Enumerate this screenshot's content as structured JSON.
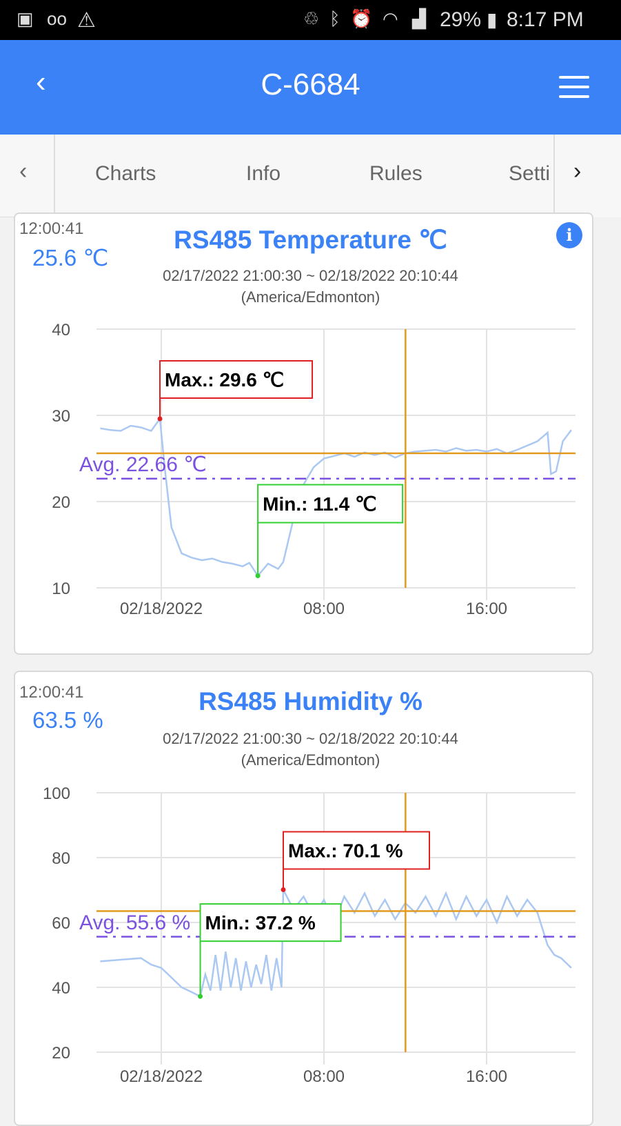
{
  "status_bar": {
    "left_icons": [
      "pulse-icon",
      "voicemail-icon",
      "warning-icon"
    ],
    "right_icons": [
      "data-saver-icon",
      "bluetooth-icon",
      "alarm-icon",
      "wifi-icon",
      "signal-icon"
    ],
    "battery": "29%",
    "time": "8:17 PM"
  },
  "header": {
    "title": "C-6684",
    "back_icon": "chevron-left-icon",
    "menu_icon": "hamburger-icon",
    "color": "#3b82f6"
  },
  "tabs": {
    "items": [
      {
        "label": "Charts",
        "active": true
      },
      {
        "label": "Info"
      },
      {
        "label": "Rules"
      },
      {
        "label": "Setti"
      }
    ]
  },
  "charts": [
    {
      "last_time": "12:00:41",
      "current": "25.6 ℃",
      "title": "RS485 Temperature ℃",
      "range": "02/17/2022 21:00:30 ~ 02/18/2022 20:10:44",
      "timezone": "(America/Edmonton)",
      "info_icon": "info-icon"
    },
    {
      "last_time": "12:00:41",
      "current": "63.5 %",
      "title": "RS485 Humidity %",
      "range": "02/17/2022 21:00:30 ~ 02/18/2022 20:10:44",
      "timezone": "(America/Edmonton)"
    }
  ],
  "chart_data": [
    {
      "type": "line",
      "yticks": [
        "40",
        "30",
        "20",
        "10"
      ],
      "ylim": [
        10,
        40
      ],
      "xticks": [
        "02/18/2022",
        "08:00",
        "16:00"
      ],
      "grid": true,
      "avg": 22.66,
      "avg_label": "Avg. 22.66 ℃",
      "current_value": 25.6,
      "cursor_time": "02-18 12:00:41",
      "max": {
        "label": "Max.: 29.6 ℃",
        "time": "02-17 23:56",
        "value": 29.6
      },
      "min": {
        "label": "Min.: 11.4 ℃",
        "time": "02-18 04:45",
        "value": 11.4
      },
      "colors": {
        "series": "#aac8f2",
        "avg": "#7b52e0",
        "current": "#e39a1c",
        "max": "#e02020",
        "min": "#30d030"
      },
      "points": [
        [
          "02-17 21:00",
          28.5
        ],
        [
          "02-17 21:30",
          28.3
        ],
        [
          "02-17 22:00",
          28.2
        ],
        [
          "02-17 22:30",
          28.8
        ],
        [
          "02-17 23:00",
          28.6
        ],
        [
          "02-17 23:30",
          28.2
        ],
        [
          "02-17 23:56",
          29.6
        ],
        [
          "02-18 00:10",
          24
        ],
        [
          "02-18 00:30",
          17
        ],
        [
          "02-18 01:00",
          14
        ],
        [
          "02-18 01:30",
          13.5
        ],
        [
          "02-18 02:00",
          13.2
        ],
        [
          "02-18 02:30",
          13.4
        ],
        [
          "02-18 03:00",
          13
        ],
        [
          "02-18 03:30",
          12.8
        ],
        [
          "02-18 04:00",
          12.5
        ],
        [
          "02-18 04:20",
          12.9
        ],
        [
          "02-18 04:45",
          11.4
        ],
        [
          "02-18 05:15",
          12.8
        ],
        [
          "02-18 05:45",
          12.2
        ],
        [
          "02-18 06:00",
          13
        ],
        [
          "02-18 06:30",
          18
        ],
        [
          "02-18 07:00",
          22
        ],
        [
          "02-18 07:30",
          24
        ],
        [
          "02-18 08:00",
          25
        ],
        [
          "02-18 08:30",
          25.3
        ],
        [
          "02-18 09:00",
          25.6
        ],
        [
          "02-18 09:30",
          25.2
        ],
        [
          "02-18 10:00",
          25.7
        ],
        [
          "02-18 10:30",
          25.4
        ],
        [
          "02-18 11:00",
          25.7
        ],
        [
          "02-18 11:30",
          25.1
        ],
        [
          "02-18 12:00",
          25.6
        ],
        [
          "02-18 12:30",
          25.8
        ],
        [
          "02-18 13:00",
          25.9
        ],
        [
          "02-18 13:30",
          26
        ],
        [
          "02-18 14:00",
          25.8
        ],
        [
          "02-18 14:30",
          26.2
        ],
        [
          "02-18 15:00",
          25.9
        ],
        [
          "02-18 15:30",
          26
        ],
        [
          "02-18 16:00",
          25.8
        ],
        [
          "02-18 16:30",
          26.1
        ],
        [
          "02-18 17:00",
          25.6
        ],
        [
          "02-18 17:30",
          26
        ],
        [
          "02-18 18:00",
          26.5
        ],
        [
          "02-18 18:30",
          27
        ],
        [
          "02-18 19:00",
          28
        ],
        [
          "02-18 19:10",
          23.2
        ],
        [
          "02-18 19:25",
          23.5
        ],
        [
          "02-18 19:45",
          27
        ],
        [
          "02-18 20:10",
          28.3
        ]
      ]
    },
    {
      "type": "line",
      "yticks": [
        "100",
        "80",
        "60",
        "40",
        "20"
      ],
      "ylim": [
        20,
        100
      ],
      "xticks": [
        "02/18/2022",
        "08:00",
        "16:00"
      ],
      "grid": true,
      "avg": 55.6,
      "avg_label": "Avg. 55.6 %",
      "current_value": 63.5,
      "cursor_time": "02-18 12:00:41",
      "max": {
        "label": "Max.: 70.1 %",
        "time": "02-18 06:00",
        "value": 70.1
      },
      "min": {
        "label": "Min.: 37.2 %",
        "time": "02-18 01:55",
        "value": 37.2
      },
      "colors": {
        "series": "#aac8f2",
        "avg": "#7b52e0",
        "current": "#e39a1c",
        "max": "#e02020",
        "min": "#30d030"
      },
      "points": [
        [
          "02-17 21:00",
          48
        ],
        [
          "02-17 22:00",
          48.5
        ],
        [
          "02-17 23:00",
          49
        ],
        [
          "02-17 23:30",
          47
        ],
        [
          "02-18 00:00",
          46
        ],
        [
          "02-18 00:30",
          43
        ],
        [
          "02-18 01:00",
          40
        ],
        [
          "02-18 01:30",
          38.5
        ],
        [
          "02-18 01:55",
          37.2
        ],
        [
          "02-18 02:10",
          44
        ],
        [
          "02-18 02:25",
          39
        ],
        [
          "02-18 02:40",
          50
        ],
        [
          "02-18 02:55",
          39
        ],
        [
          "02-18 03:10",
          51
        ],
        [
          "02-18 03:25",
          40
        ],
        [
          "02-18 03:40",
          49
        ],
        [
          "02-18 03:55",
          39
        ],
        [
          "02-18 04:10",
          48
        ],
        [
          "02-18 04:25",
          40
        ],
        [
          "02-18 04:40",
          47
        ],
        [
          "02-18 04:55",
          41
        ],
        [
          "02-18 05:10",
          50
        ],
        [
          "02-18 05:25",
          39
        ],
        [
          "02-18 05:40",
          49
        ],
        [
          "02-18 05:55",
          40
        ],
        [
          "02-18 06:00",
          70.1
        ],
        [
          "02-18 06:30",
          64
        ],
        [
          "02-18 07:00",
          68
        ],
        [
          "02-18 07:30",
          62
        ],
        [
          "02-18 08:00",
          67
        ],
        [
          "02-18 08:30",
          60
        ],
        [
          "02-18 09:00",
          68
        ],
        [
          "02-18 09:30",
          63
        ],
        [
          "02-18 10:00",
          69
        ],
        [
          "02-18 10:30",
          62
        ],
        [
          "02-18 11:00",
          67
        ],
        [
          "02-18 11:30",
          61
        ],
        [
          "02-18 12:00",
          66
        ],
        [
          "02-18 12:30",
          63
        ],
        [
          "02-18 13:00",
          68
        ],
        [
          "02-18 13:30",
          62
        ],
        [
          "02-18 14:00",
          69
        ],
        [
          "02-18 14:30",
          61
        ],
        [
          "02-18 15:00",
          68
        ],
        [
          "02-18 15:30",
          62
        ],
        [
          "02-18 16:00",
          67
        ],
        [
          "02-18 16:30",
          60
        ],
        [
          "02-18 17:00",
          68
        ],
        [
          "02-18 17:30",
          62
        ],
        [
          "02-18 18:00",
          67
        ],
        [
          "02-18 18:30",
          63
        ],
        [
          "02-18 19:00",
          53
        ],
        [
          "02-18 19:20",
          50
        ],
        [
          "02-18 19:40",
          49
        ],
        [
          "02-18 20:10",
          46
        ]
      ]
    }
  ]
}
